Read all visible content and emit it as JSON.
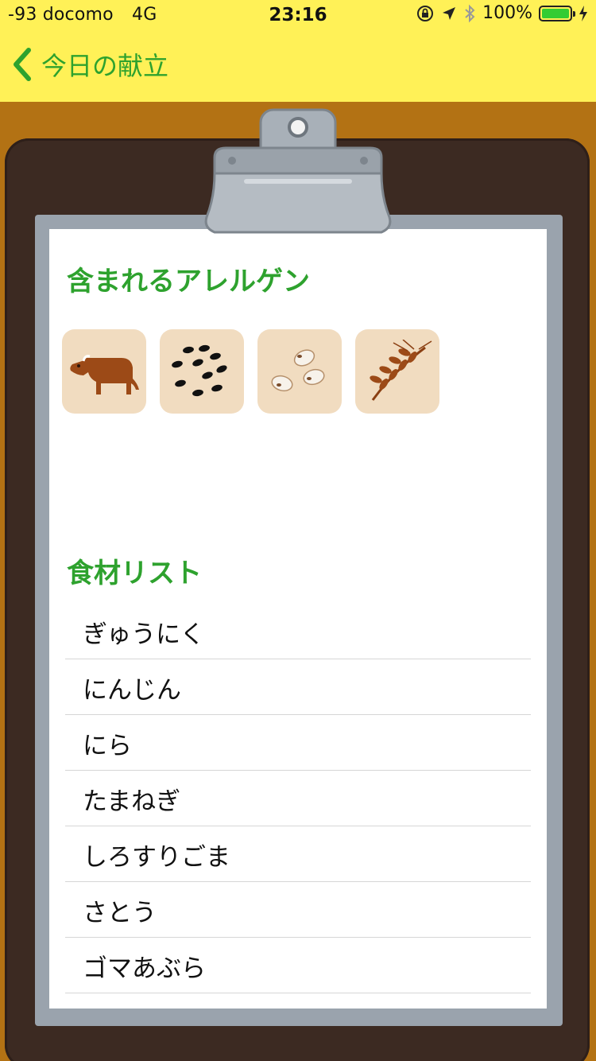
{
  "status_bar": {
    "carrier": "-93 docomo",
    "network": "4G",
    "time": "23:16",
    "battery": "100%"
  },
  "nav": {
    "back_label": "今日の献立"
  },
  "allergens": {
    "title": "含まれるアレルゲン",
    "items": [
      {
        "icon": "beef-icon"
      },
      {
        "icon": "sesame-icon"
      },
      {
        "icon": "soybean-icon"
      },
      {
        "icon": "wheat-icon"
      }
    ]
  },
  "ingredients": {
    "title": "食材リスト",
    "items": [
      "ぎゅうにく",
      "にんじん",
      "にら",
      "たまねぎ",
      "しろすりごま",
      "さとう",
      "ゴマあぶら"
    ]
  },
  "colors": {
    "header_bg": "#fff157",
    "accent_green": "#2ea22e",
    "background_wood": "#b37214",
    "clipboard_board": "#3c2a22",
    "allergen_tile": "#f1dcc0"
  }
}
